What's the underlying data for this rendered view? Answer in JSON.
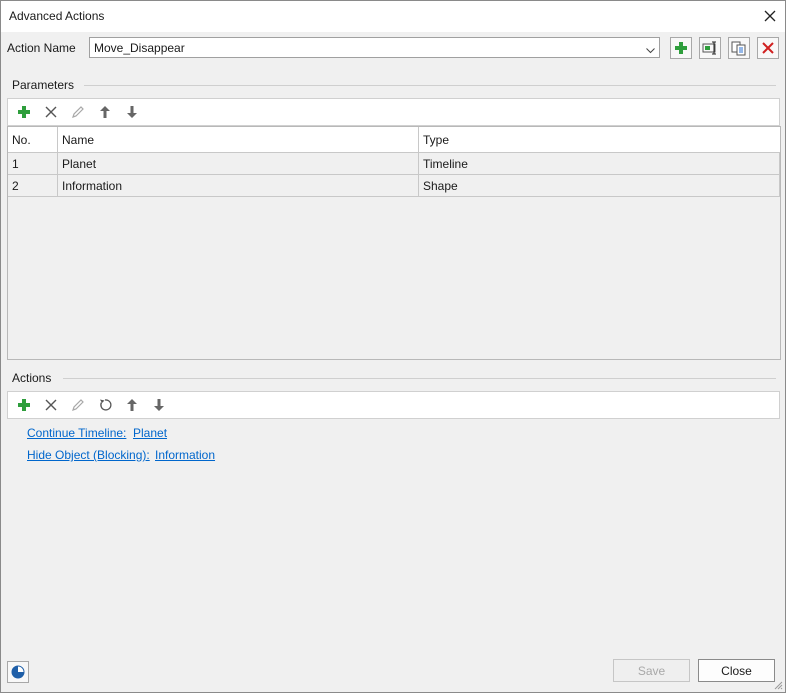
{
  "window": {
    "title": "Advanced Actions"
  },
  "action_name": {
    "label": "Action Name",
    "value": "Move_Disappear"
  },
  "parameters": {
    "title": "Parameters",
    "columns": [
      "No.",
      "Name",
      "Type"
    ],
    "rows": [
      {
        "no": "1",
        "name": "Planet",
        "type": "Timeline"
      },
      {
        "no": "2",
        "name": "Information",
        "type": "Shape"
      }
    ]
  },
  "actions": {
    "title": "Actions",
    "items": [
      {
        "action": "Continue Timeline:",
        "target": "Planet"
      },
      {
        "action": "Hide Object (Blocking):",
        "target": "Information"
      }
    ]
  },
  "footer": {
    "save_label": "Save",
    "close_label": "Close"
  },
  "icons": {
    "add": "plus-icon",
    "delete": "x-icon",
    "edit": "pencil-icon",
    "up": "arrow-up-icon",
    "down": "arrow-down-icon",
    "reset": "rotate-icon",
    "copy": "copy-icon",
    "rename": "rename-icon",
    "remove": "red-x-icon",
    "chart": "pie-chart-icon"
  },
  "colors": {
    "link": "#0066cc",
    "add_green": "#2e9e3c",
    "remove_red": "#d02020"
  }
}
